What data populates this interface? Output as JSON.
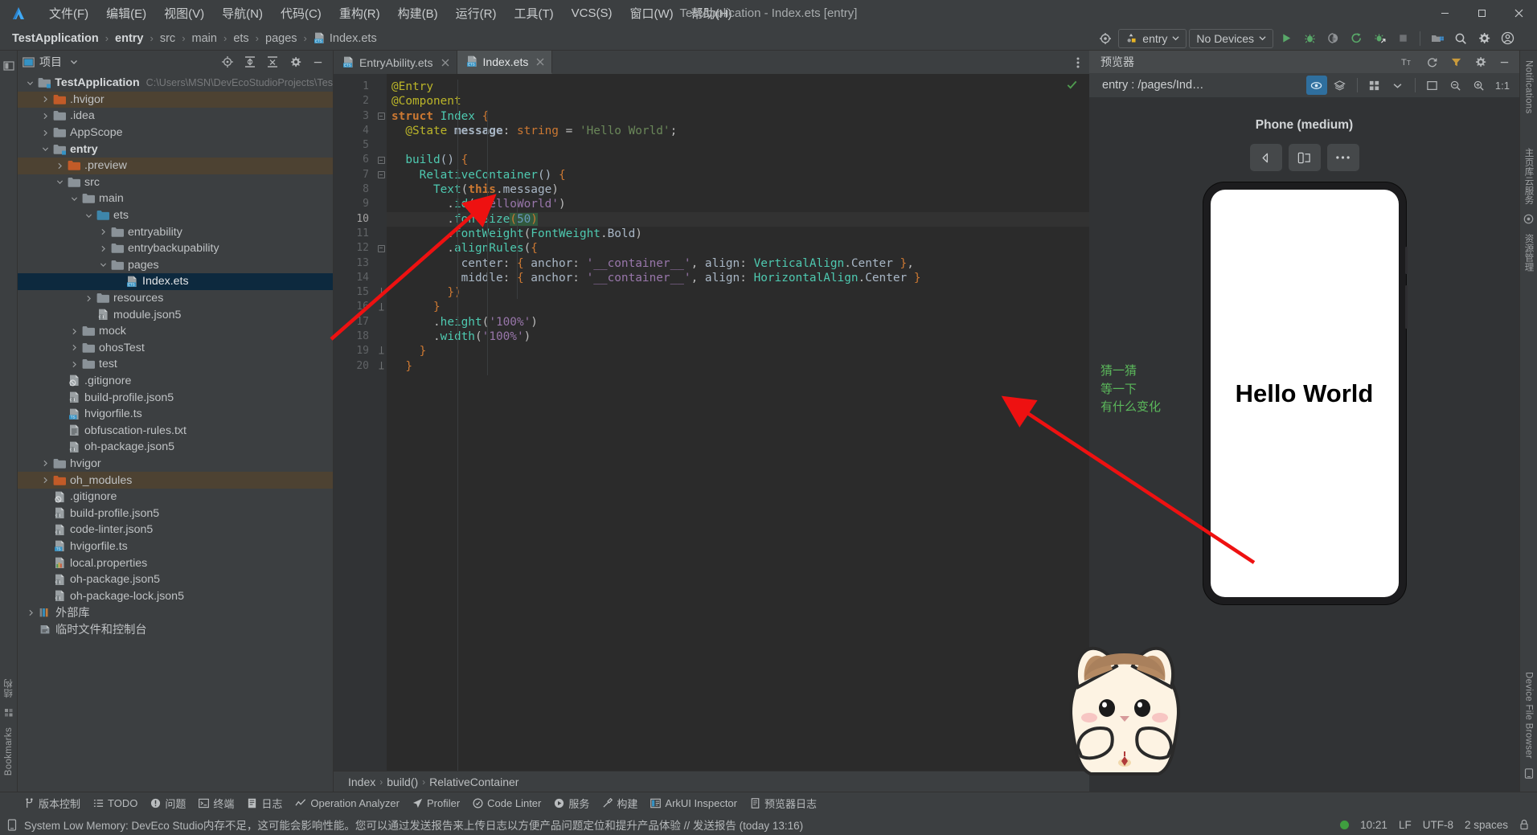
{
  "window": {
    "title": "TestApplication - Index.ets [entry]",
    "minimize_label": "—",
    "maximize_label": "❐",
    "close_label": "✕"
  },
  "menu": {
    "items": [
      {
        "label": "文件(F)"
      },
      {
        "label": "编辑(E)"
      },
      {
        "label": "视图(V)"
      },
      {
        "label": "导航(N)"
      },
      {
        "label": "代码(C)"
      },
      {
        "label": "重构(R)"
      },
      {
        "label": "构建(B)"
      },
      {
        "label": "运行(R)"
      },
      {
        "label": "工具(T)"
      },
      {
        "label": "VCS(S)"
      },
      {
        "label": "窗口(W)"
      },
      {
        "label": "帮助(H)"
      }
    ]
  },
  "breadcrumb": {
    "items": [
      "TestApplication",
      "entry",
      "src",
      "main",
      "ets",
      "pages"
    ],
    "file": "Index.ets",
    "separator": "›"
  },
  "toolbar": {
    "device_target": "entry",
    "device_list": "No Devices",
    "icons": [
      "settings-target-icon",
      "run-icon",
      "debug-icon",
      "run-coverage-icon",
      "rerun-icon",
      "attach-debugger-icon",
      "stop-icon",
      "project-structure-icon",
      "search-everywhere-icon",
      "settings-icon",
      "account-icon"
    ]
  },
  "project_panel": {
    "title": "项目",
    "header_icons": [
      "locate-icon",
      "expand-all-icon",
      "collapse-all-icon",
      "gear-icon",
      "hide-icon"
    ],
    "tree": [
      {
        "depth": 0,
        "label": "TestApplication",
        "suffix": "C:\\Users\\MSN\\DevEcoStudioProjects\\Tes",
        "arrow": "down",
        "icon": "module-folder",
        "bold": true
      },
      {
        "depth": 1,
        "label": ".hvigor",
        "suffix": "",
        "arrow": "right",
        "icon": "folder-orange",
        "excluded": true
      },
      {
        "depth": 1,
        "label": ".idea",
        "suffix": "",
        "arrow": "right",
        "icon": "folder"
      },
      {
        "depth": 1,
        "label": "AppScope",
        "suffix": "",
        "arrow": "right",
        "icon": "folder"
      },
      {
        "depth": 1,
        "label": "entry",
        "suffix": "",
        "arrow": "down",
        "icon": "module-folder",
        "bold": true
      },
      {
        "depth": 2,
        "label": ".preview",
        "suffix": "",
        "arrow": "right",
        "icon": "folder-orange",
        "excluded": true
      },
      {
        "depth": 2,
        "label": "src",
        "suffix": "",
        "arrow": "down",
        "icon": "folder"
      },
      {
        "depth": 3,
        "label": "main",
        "suffix": "",
        "arrow": "down",
        "icon": "folder"
      },
      {
        "depth": 4,
        "label": "ets",
        "suffix": "",
        "arrow": "down",
        "icon": "folder-blue"
      },
      {
        "depth": 5,
        "label": "entryability",
        "suffix": "",
        "arrow": "right",
        "icon": "folder"
      },
      {
        "depth": 5,
        "label": "entrybackupability",
        "suffix": "",
        "arrow": "right",
        "icon": "folder"
      },
      {
        "depth": 5,
        "label": "pages",
        "suffix": "",
        "arrow": "down",
        "icon": "folder"
      },
      {
        "depth": 6,
        "label": "Index.ets",
        "suffix": "",
        "arrow": "none",
        "icon": "ets-file",
        "selected": true
      },
      {
        "depth": 4,
        "label": "resources",
        "suffix": "",
        "arrow": "right",
        "icon": "folder"
      },
      {
        "depth": 4,
        "label": "module.json5",
        "suffix": "",
        "arrow": "none",
        "icon": "json5-file"
      },
      {
        "depth": 3,
        "label": "mock",
        "suffix": "",
        "arrow": "right",
        "icon": "folder"
      },
      {
        "depth": 3,
        "label": "ohosTest",
        "suffix": "",
        "arrow": "right",
        "icon": "folder"
      },
      {
        "depth": 3,
        "label": "test",
        "suffix": "",
        "arrow": "right",
        "icon": "folder"
      },
      {
        "depth": 2,
        "label": ".gitignore",
        "suffix": "",
        "arrow": "none",
        "icon": "gitignore-file"
      },
      {
        "depth": 2,
        "label": "build-profile.json5",
        "suffix": "",
        "arrow": "none",
        "icon": "json5-file"
      },
      {
        "depth": 2,
        "label": "hvigorfile.ts",
        "suffix": "",
        "arrow": "none",
        "icon": "ts-file"
      },
      {
        "depth": 2,
        "label": "obfuscation-rules.txt",
        "suffix": "",
        "arrow": "none",
        "icon": "txt-file"
      },
      {
        "depth": 2,
        "label": "oh-package.json5",
        "suffix": "",
        "arrow": "none",
        "icon": "json5-file"
      },
      {
        "depth": 1,
        "label": "hvigor",
        "suffix": "",
        "arrow": "right",
        "icon": "folder"
      },
      {
        "depth": 1,
        "label": "oh_modules",
        "suffix": "",
        "arrow": "right",
        "icon": "folder-orange",
        "excluded": true
      },
      {
        "depth": 1,
        "label": ".gitignore",
        "suffix": "",
        "arrow": "none",
        "icon": "gitignore-file"
      },
      {
        "depth": 1,
        "label": "build-profile.json5",
        "suffix": "",
        "arrow": "none",
        "icon": "json5-file"
      },
      {
        "depth": 1,
        "label": "code-linter.json5",
        "suffix": "",
        "arrow": "none",
        "icon": "json5-file"
      },
      {
        "depth": 1,
        "label": "hvigorfile.ts",
        "suffix": "",
        "arrow": "none",
        "icon": "ts-file"
      },
      {
        "depth": 1,
        "label": "local.properties",
        "suffix": "",
        "arrow": "none",
        "icon": "properties-file"
      },
      {
        "depth": 1,
        "label": "oh-package.json5",
        "suffix": "",
        "arrow": "none",
        "icon": "json5-file"
      },
      {
        "depth": 1,
        "label": "oh-package-lock.json5",
        "suffix": "",
        "arrow": "none",
        "icon": "json5-file"
      },
      {
        "depth": 0,
        "label": "外部库",
        "suffix": "",
        "arrow": "right",
        "icon": "library-icon"
      },
      {
        "depth": 0,
        "label": "临时文件和控制台",
        "suffix": "",
        "arrow": "none",
        "icon": "scratch-icon"
      }
    ]
  },
  "editor": {
    "tabs": [
      {
        "label": "EntryAbility.ets",
        "active": false
      },
      {
        "label": "Index.ets",
        "active": true
      }
    ],
    "current_line": 10,
    "inspection_ok": true,
    "lines": [
      {
        "n": 1,
        "fold": "none",
        "text": "@Entry"
      },
      {
        "n": 2,
        "fold": "none",
        "text": "@Component"
      },
      {
        "n": 3,
        "fold": "minus",
        "text": "struct Index {"
      },
      {
        "n": 4,
        "fold": "none",
        "text": "  @State message: string = 'Hello World';"
      },
      {
        "n": 5,
        "fold": "none",
        "text": ""
      },
      {
        "n": 6,
        "fold": "minus",
        "text": "  build() {"
      },
      {
        "n": 7,
        "fold": "minus",
        "text": "    RelativeContainer() {"
      },
      {
        "n": 8,
        "fold": "none",
        "text": "      Text(this.message)"
      },
      {
        "n": 9,
        "fold": "none",
        "text": "        .id('HelloWorld')"
      },
      {
        "n": 10,
        "fold": "none",
        "text": "        .fontSize(50)"
      },
      {
        "n": 11,
        "fold": "none",
        "text": "        .fontWeight(FontWeight.Bold)"
      },
      {
        "n": 12,
        "fold": "minus",
        "text": "        .alignRules({"
      },
      {
        "n": 13,
        "fold": "none",
        "text": "          center: { anchor: '__container__', align: VerticalAlign.Center },"
      },
      {
        "n": 14,
        "fold": "none",
        "text": "          middle: { anchor: '__container__', align: HorizontalAlign.Center }"
      },
      {
        "n": 15,
        "fold": "minus-end",
        "text": "        })"
      },
      {
        "n": 16,
        "fold": "minus-end",
        "text": "      }"
      },
      {
        "n": 17,
        "fold": "none",
        "text": "      .height('100%')"
      },
      {
        "n": 18,
        "fold": "none",
        "text": "      .width('100%')"
      },
      {
        "n": 19,
        "fold": "minus-end",
        "text": "    }"
      },
      {
        "n": 20,
        "fold": "minus-end",
        "text": "  }"
      }
    ],
    "breadcrumb": [
      "Index",
      "build()",
      "RelativeContainer"
    ],
    "breadcrumb_separator": "›"
  },
  "previewer": {
    "title": "预览器",
    "route": "entry : /pages/Ind…",
    "device_name": "Phone (medium)",
    "zoom_label": "1:1",
    "preview_text": "Hello World",
    "header_icons": [
      "font-size-icon",
      "refresh-icon",
      "filter-icon",
      "settings-icon",
      "hide-icon"
    ],
    "sub_icons": [
      "inspector-icon",
      "layers-icon",
      "grid-icon",
      "chevron-down-icon",
      "fit-icon",
      "zoom-out-icon",
      "zoom-in-icon"
    ],
    "ctrl_icons": [
      "rotate-icon",
      "multi-device-icon",
      "more-icon"
    ],
    "annotation": [
      "猜一猜",
      "等一下",
      "有什么变化"
    ]
  },
  "bottom_bar": {
    "items": [
      {
        "label": "版本控制",
        "icon": "vcs-icon"
      },
      {
        "label": "TODO",
        "icon": "todo-icon"
      },
      {
        "label": "问题",
        "icon": "problems-icon"
      },
      {
        "label": "终端",
        "icon": "terminal-icon"
      },
      {
        "label": "日志",
        "icon": "log-icon"
      },
      {
        "label": "Operation Analyzer",
        "icon": "analyzer-icon"
      },
      {
        "label": "Profiler",
        "icon": "profiler-icon"
      },
      {
        "label": "Code Linter",
        "icon": "linter-icon"
      },
      {
        "label": "服务",
        "icon": "services-icon"
      },
      {
        "label": "构建",
        "icon": "build-icon"
      },
      {
        "label": "ArkUI Inspector",
        "icon": "arkui-icon"
      },
      {
        "label": "预览器日志",
        "icon": "preview-log-icon"
      }
    ]
  },
  "status_bar": {
    "message": "System Low Memory: DevEco Studio内存不足，这可能会影响性能。您可以通过发送报告来上传日志以方便产品问题定位和提升产品体验 // 发送报告 (today 13:16)",
    "time": "10:21",
    "line_sep": "LF",
    "encoding": "UTF-8",
    "indent": "2 spaces",
    "lock_icon": "lock-icon"
  },
  "left_strip": {
    "labels": [
      "结构",
      "Bookmarks"
    ],
    "top_icon": "project-strip-icon"
  },
  "right_strip": {
    "labels": [
      "Notifications",
      "主页库云服务",
      "资源管理",
      "Device File Browser"
    ]
  },
  "colors": {
    "accent_green": "#5bb85b",
    "selection_blue": "#0d293e",
    "excluded_tan": "#4d4232",
    "arrow_red": "#ee1111",
    "panel_bg": "#3c3f41",
    "editor_bg": "#2b2b2b",
    "gutter_bg": "#313335"
  }
}
